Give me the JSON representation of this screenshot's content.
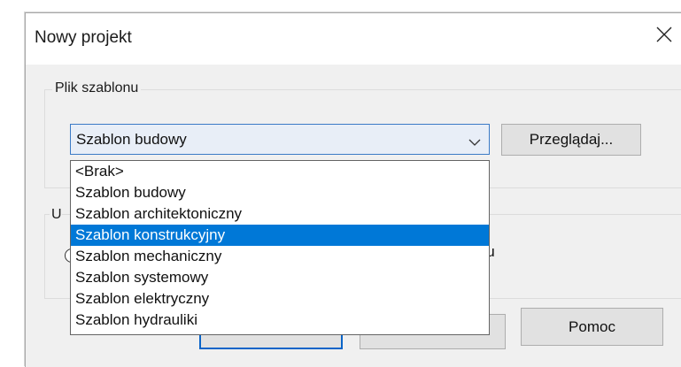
{
  "window": {
    "title": "Nowy projekt",
    "close_icon": "close-icon"
  },
  "template_group": {
    "label": "Plik szablonu",
    "select": {
      "value": "Szablon budowy",
      "chevron_icon": "chevron-down-icon"
    },
    "browse_label": "Przeglądaj..."
  },
  "second_group": {
    "label_fragment": "U",
    "text_fragment": "ktu"
  },
  "dropdown": {
    "options": [
      "<Brak>",
      "Szablon budowy",
      "Szablon architektoniczny",
      "Szablon konstrukcyjny",
      "Szablon mechaniczny",
      "Szablon systemowy",
      "Szablon elektryczny",
      "Szablon hydrauliki"
    ],
    "highlighted": "Szablon konstrukcyjny"
  },
  "buttons": {
    "help_label": "Pomoc"
  },
  "colors": {
    "accent": "#0078d7",
    "dialog_bg": "#f0f0f0",
    "select_border": "#3a7ac6"
  }
}
